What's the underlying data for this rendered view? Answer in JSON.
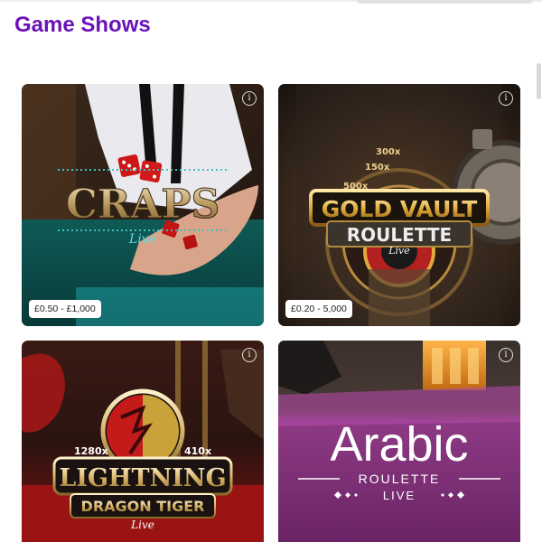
{
  "page": {
    "title": "Game Shows"
  },
  "games": [
    {
      "id": "craps",
      "limits": "£0.50 - £1,000",
      "logo_lines": [
        "CRAPS",
        "Live"
      ]
    },
    {
      "id": "gold-vault-roulette",
      "limits": "£0.20 - 5,000",
      "logo_lines": [
        "GOLD VAULT",
        "ROULETTE",
        "Live"
      ],
      "wheel_multipliers": [
        "150x",
        "300x",
        "500x"
      ]
    },
    {
      "id": "lightning-dragon-tiger",
      "logo_lines": [
        "LIGHTNING",
        "DRAGON TIGER",
        "Live"
      ],
      "multipliers": [
        "1280x",
        "410x"
      ]
    },
    {
      "id": "arabic-roulette",
      "logo_lines": [
        "Arabic",
        "ROULETTE",
        "LIVE"
      ]
    }
  ],
  "icons": {
    "info": "info-icon"
  },
  "colors": {
    "brand": "#6a13b8"
  }
}
